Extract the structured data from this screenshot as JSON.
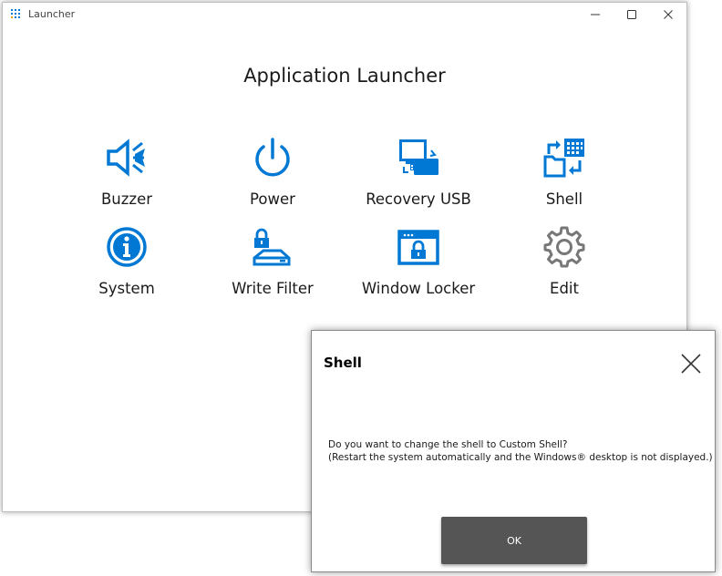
{
  "window": {
    "title": "Launcher",
    "heading": "Application Launcher"
  },
  "tiles": [
    {
      "label": "Buzzer",
      "icon": "speaker-icon"
    },
    {
      "label": "Power",
      "icon": "power-icon"
    },
    {
      "label": "Recovery USB",
      "icon": "usb-recovery-icon"
    },
    {
      "label": "Shell",
      "icon": "shell-swap-icon"
    },
    {
      "label": "System",
      "icon": "info-icon"
    },
    {
      "label": "Write Filter",
      "icon": "drive-lock-icon"
    },
    {
      "label": "Window Locker",
      "icon": "window-lock-icon"
    },
    {
      "label": "Edit",
      "icon": "gear-icon"
    }
  ],
  "dialog": {
    "title": "Shell",
    "message_line1": "Do you want to change the shell to Custom Shell?",
    "message_line2": "(Restart the system automatically and the Windows® desktop is not displayed.)",
    "ok_label": "OK"
  },
  "colors": {
    "accent": "#0078d4",
    "gear": "#777777",
    "ok_button": "#555555"
  }
}
